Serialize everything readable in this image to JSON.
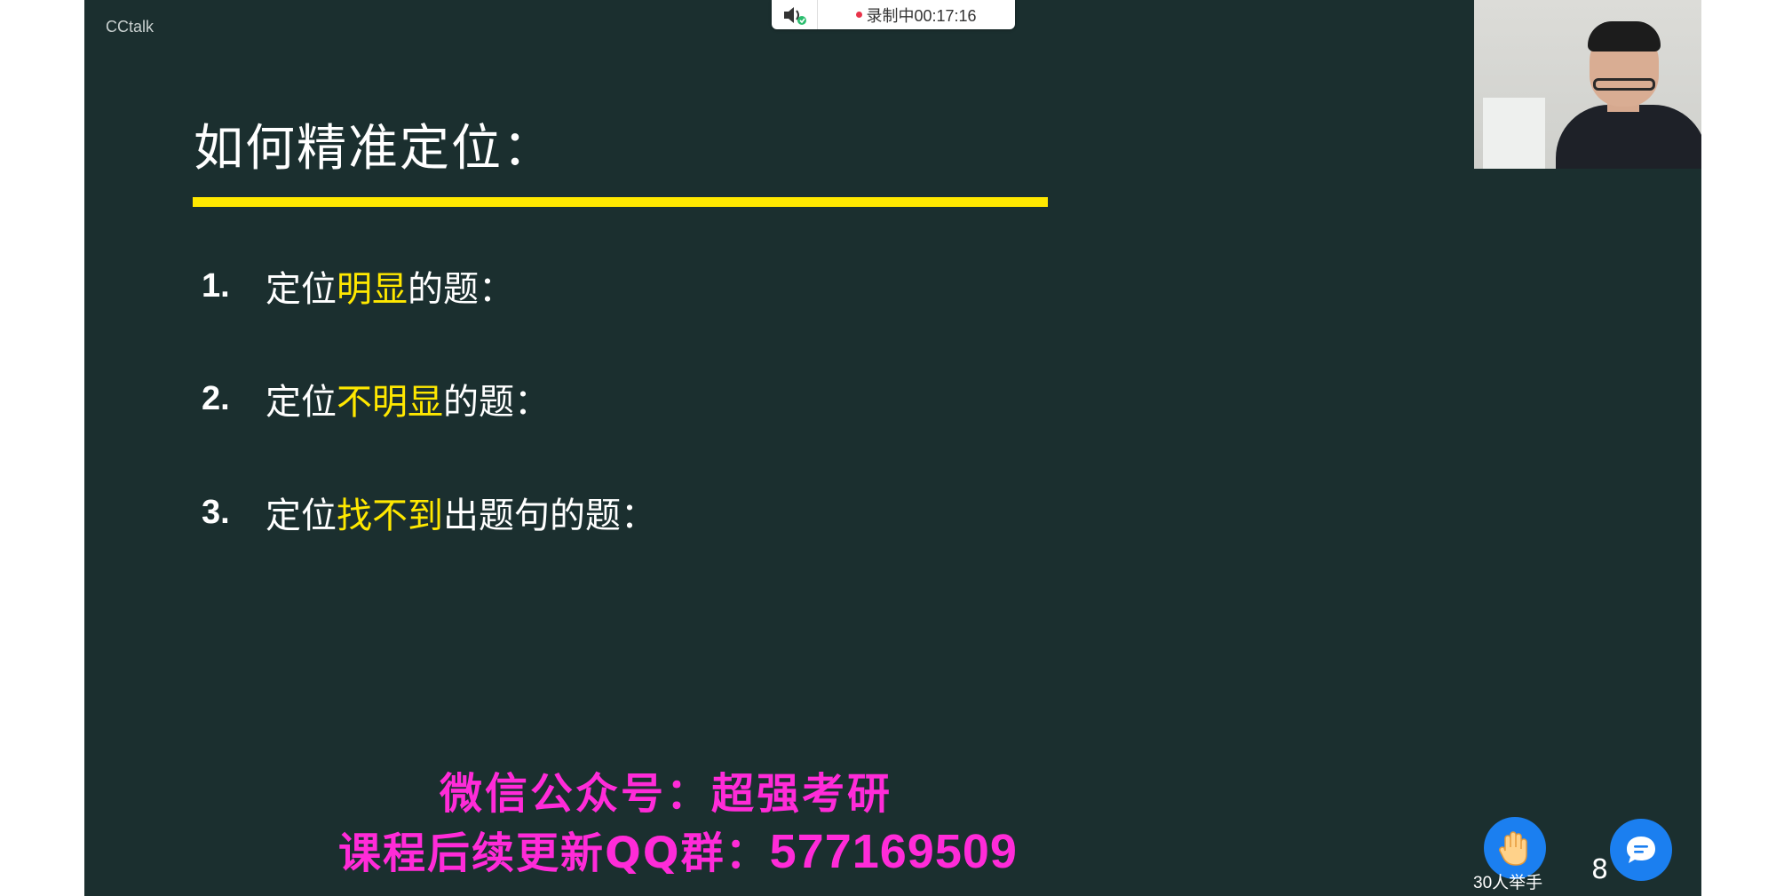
{
  "app": {
    "name": "CCtalk"
  },
  "recording": {
    "status_text": "录制中00:17:16"
  },
  "slide": {
    "title": "如何精准定位：",
    "items": [
      {
        "number": "1.",
        "parts": [
          "定位",
          "明显",
          "的题："
        ]
      },
      {
        "number": "2.",
        "parts": [
          "定位",
          "不明显",
          "的题："
        ]
      },
      {
        "number": "3.",
        "parts": [
          "定位",
          "找不到",
          "出题句的题："
        ]
      }
    ]
  },
  "promo": {
    "line1": "微信公众号：超强考研",
    "line2_prefix": "课程后续更新QQ群：",
    "line2_number": "577169509"
  },
  "controls": {
    "raise_hand_label": "30人举手",
    "page_number": "8"
  },
  "colors": {
    "slide_bg": "#1b2f2f",
    "highlight_yellow": "#ffe800",
    "promo_magenta": "#ff2bd8",
    "button_blue": "#1b7ff0",
    "recording_dot": "#e8334a"
  },
  "icons": {
    "speaker": "speaker-icon",
    "raise_hand": "raise-hand-icon",
    "chat": "chat-bubble-icon"
  }
}
